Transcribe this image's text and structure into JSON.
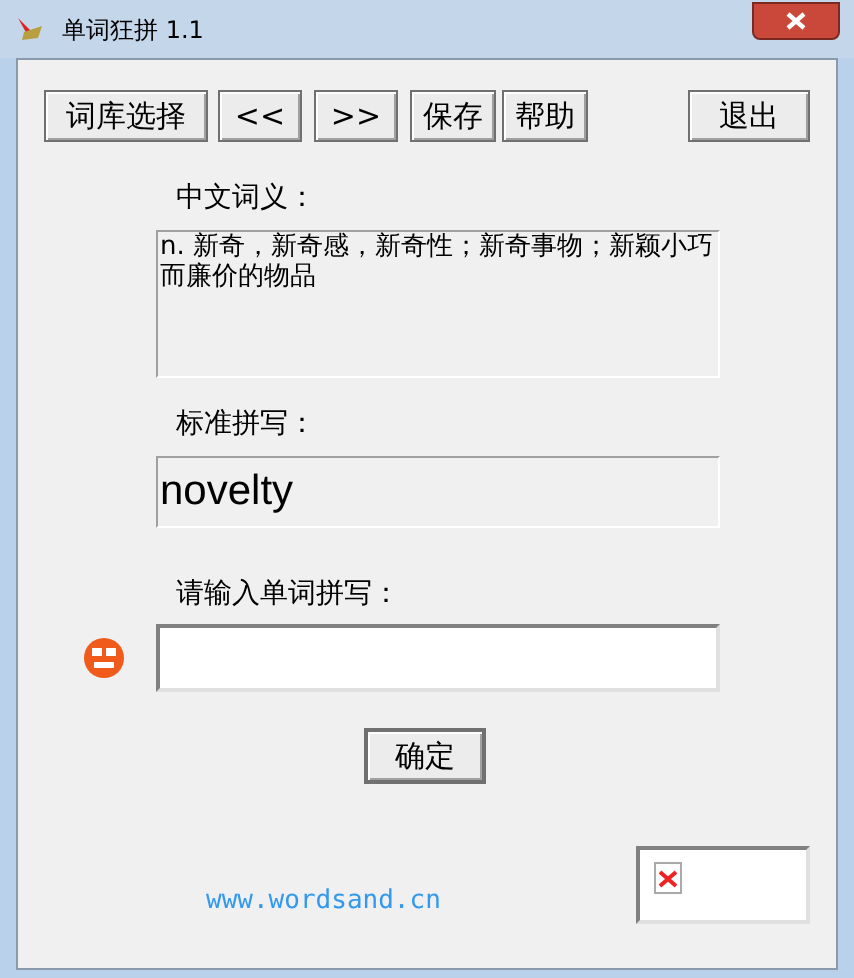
{
  "window": {
    "title": "单词狂拼 1.1"
  },
  "toolbar": [
    {
      "label": "词库选择"
    },
    {
      "label": "<<"
    },
    {
      "label": ">>"
    },
    {
      "label": "保存"
    },
    {
      "label": "帮助"
    }
  ],
  "exit_button": {
    "label": "退出"
  },
  "meaning": {
    "label": "中文词义：",
    "text": "n. 新奇，新奇感，新奇性；新奇事物；新颖小巧而廉价的物品"
  },
  "spelling": {
    "label": "标准拼写：",
    "value": "novelty"
  },
  "answer": {
    "label": "请输入单词拼写："
  },
  "confirm_button": {
    "label": "确定"
  },
  "footer_link": "www.wordsand.cn"
}
